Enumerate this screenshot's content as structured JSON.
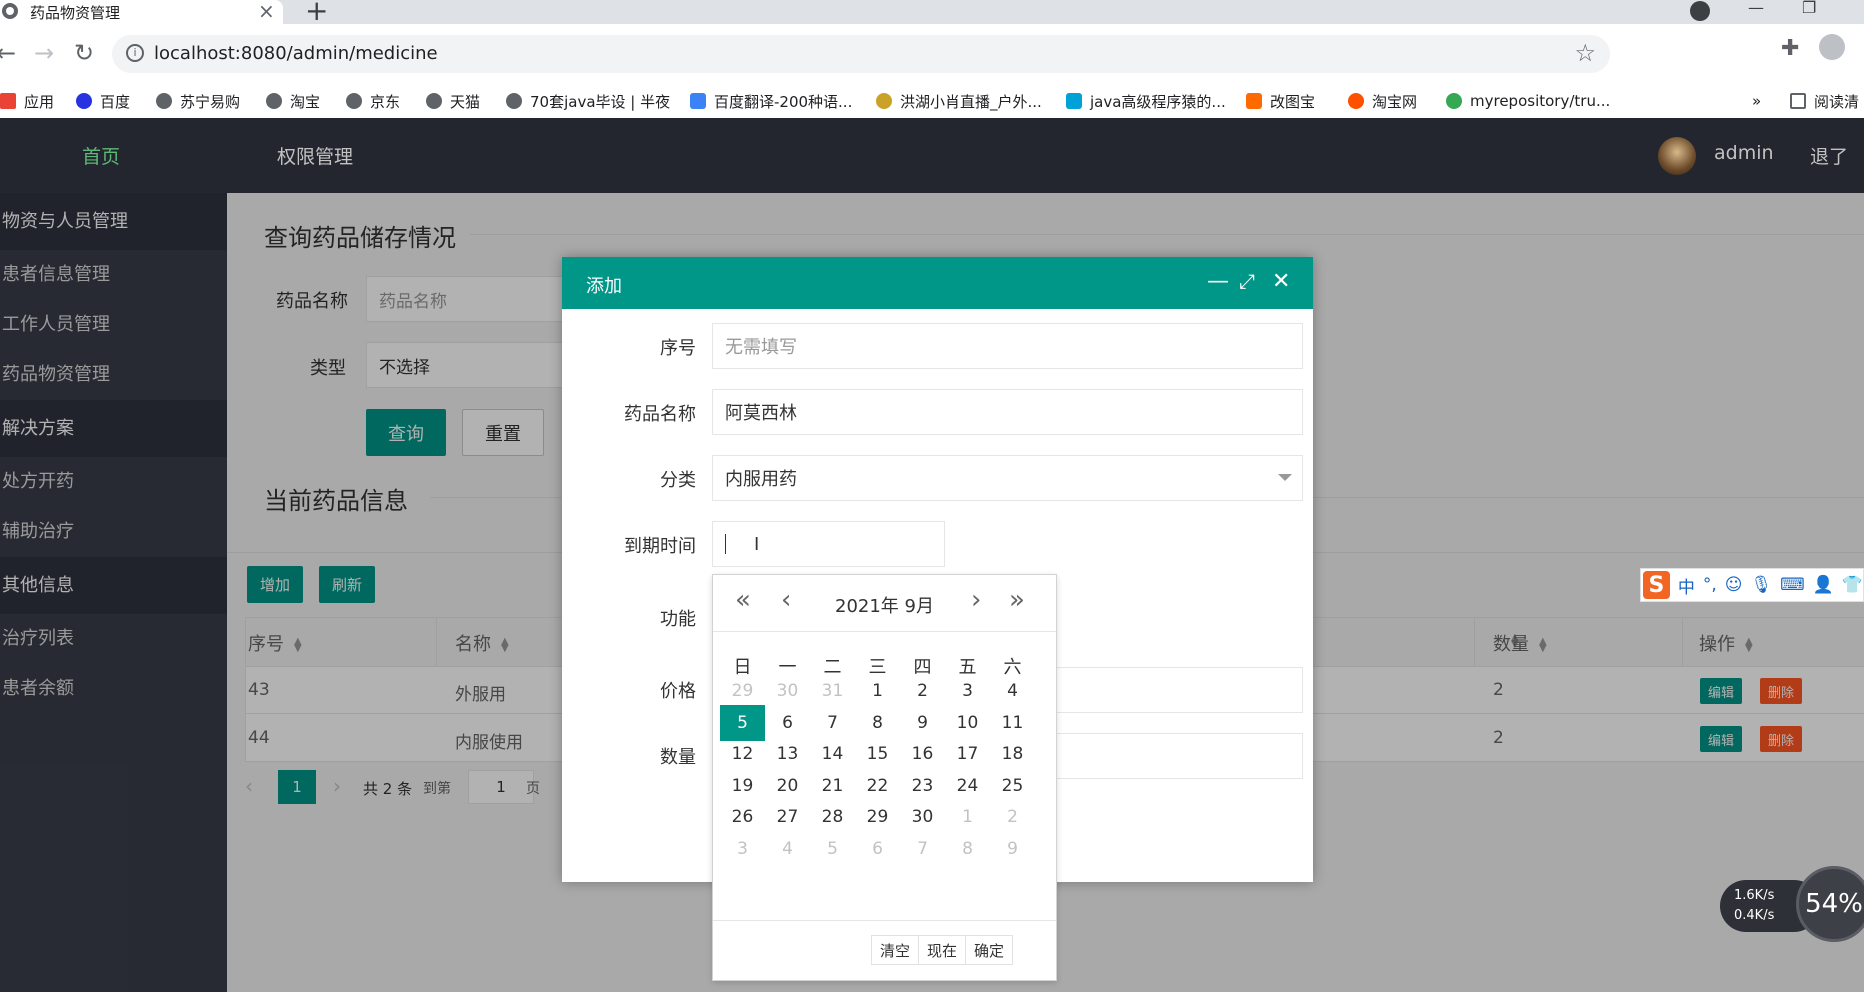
{
  "browser": {
    "tab_title": "药品物资管理",
    "url": "localhost:8080/admin/medicine",
    "bookmarks": [
      "应用",
      "百度",
      "苏宁易购",
      "淘宝",
      "京东",
      "天猫",
      "70套java毕设 | 半夜",
      "百度翻译-200种语...",
      "洪湖小肖直播_户外...",
      "java高级程序猿的...",
      "改图宝",
      "淘宝网",
      "myrepository/tru..."
    ],
    "reading_list": "阅读清"
  },
  "header": {
    "nav": [
      "首页",
      "权限管理"
    ],
    "username": "admin",
    "logout": "退了"
  },
  "sidebar": {
    "items": [
      {
        "label": "物资与人员管理",
        "group": true
      },
      {
        "label": "患者信息管理",
        "group": false
      },
      {
        "label": "工作人员管理",
        "group": false
      },
      {
        "label": "药品物资管理",
        "group": false
      },
      {
        "label": "解决方案",
        "group": true
      },
      {
        "label": "处方开药",
        "group": false
      },
      {
        "label": "辅助治疗",
        "group": false
      },
      {
        "label": "其他信息",
        "group": true
      },
      {
        "label": "治疗列表",
        "group": false
      },
      {
        "label": "患者余额",
        "group": false
      }
    ]
  },
  "query": {
    "title": "查询药品储存情况",
    "name_label": "药品名称",
    "name_placeholder": "药品名称",
    "type_label": "类型",
    "type_value": "不选择",
    "search_btn": "查询",
    "reset_btn": "重置"
  },
  "list": {
    "title": "当前药品信息",
    "add_btn": "增加",
    "refresh_btn": "刷新",
    "columns": [
      "序号",
      "名称",
      "数量",
      "操作"
    ],
    "rows": [
      {
        "id": "43",
        "name": "外服用",
        "qty": "2"
      },
      {
        "id": "44",
        "name": "内服使用",
        "qty": "2"
      }
    ],
    "edit_label": "编辑",
    "delete_label": "删除",
    "pager": {
      "current": "1",
      "total": "共 2 条",
      "goto": "到第",
      "page_value": "1",
      "page_unit": "页"
    }
  },
  "modal": {
    "title": "添加",
    "fields": {
      "id_label": "序号",
      "id_placeholder": "无需填写",
      "name_label": "药品名称",
      "name_value": "阿莫西林",
      "category_label": "分类",
      "category_value": "内服用药",
      "expiry_label": "到期时间",
      "function_label": "功能",
      "price_label": "价格",
      "qty_label": "数量"
    }
  },
  "datepicker": {
    "year_month": "2021年  9月",
    "weekdays": [
      "日",
      "一",
      "二",
      "三",
      "四",
      "五",
      "六"
    ],
    "weeks": [
      [
        "29",
        "30",
        "31",
        "1",
        "2",
        "3",
        "4"
      ],
      [
        "5",
        "6",
        "7",
        "8",
        "9",
        "10",
        "11"
      ],
      [
        "12",
        "13",
        "14",
        "15",
        "16",
        "17",
        "18"
      ],
      [
        "19",
        "20",
        "21",
        "22",
        "23",
        "24",
        "25"
      ],
      [
        "26",
        "27",
        "28",
        "29",
        "30",
        "1",
        "2"
      ],
      [
        "3",
        "4",
        "5",
        "6",
        "7",
        "8",
        "9"
      ]
    ],
    "selected": "5",
    "clear": "清空",
    "now": "现在",
    "confirm": "确定"
  },
  "ime": {
    "lang": "中"
  },
  "network": {
    "up": "1.6K/s",
    "down": "0.4K/s",
    "percent": "54%"
  },
  "colors": {
    "primary": "#009688",
    "danger": "#ff5722",
    "header": "#23262e",
    "sidebar": "#393d49"
  }
}
